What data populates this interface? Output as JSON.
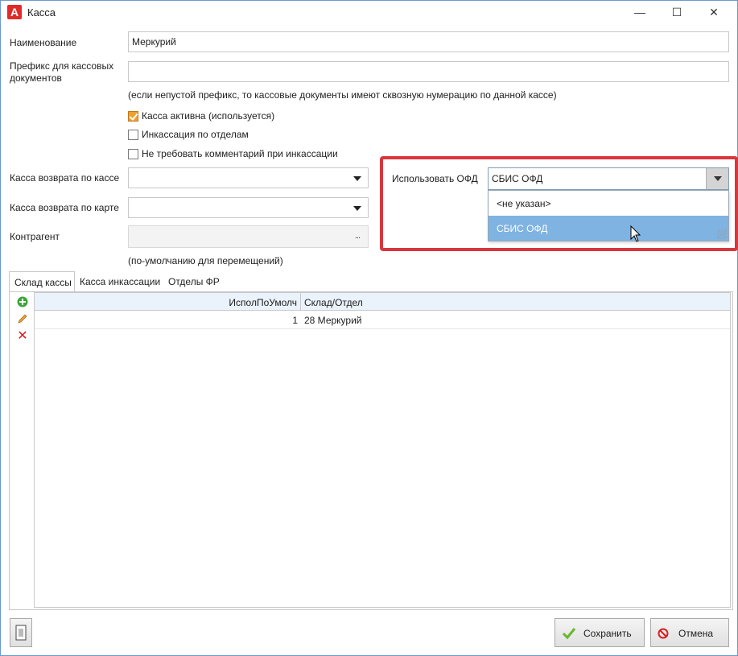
{
  "window": {
    "title": "Касса",
    "app_icon": "A",
    "btn_minimize": "—",
    "btn_maximize": "☐",
    "btn_close": "✕"
  },
  "form": {
    "name_label": "Наименование",
    "name_value": "Меркурий",
    "prefix_label": "Префикс для кассовых документов",
    "prefix_value": "",
    "prefix_hint": "(если непустой префикс, то кассовые документы имеют сквозную нумерацию по данной кассе)",
    "checkboxes": [
      {
        "label": "Касса активна (используется)",
        "checked": true
      },
      {
        "label": "Инкассация по отделам",
        "checked": false
      },
      {
        "label": "Не требовать комментарий при инкассации",
        "checked": false
      }
    ],
    "return_cash_label": "Касса возврата по кассе",
    "return_cash_value": "",
    "return_card_label": "Касса возврата по карте",
    "return_card_value": "",
    "contractor_label": "Контрагент",
    "contractor_value": "",
    "contractor_ellipsis": "...",
    "contractor_hint": "(по-умолчанию для перемещений)",
    "ofd_label": "Использовать ОФД",
    "ofd_value": "СБИС ОФД",
    "ofd_options": [
      "<не указан>",
      "СБИС ОФД"
    ],
    "ofd_selected_index": 1
  },
  "tabs": [
    "Склад кассы",
    "Касса инкассации",
    "Отделы ФР"
  ],
  "toolbar": {
    "add_icon": "+",
    "edit_icon": "✎",
    "delete_icon": "✕"
  },
  "grid": {
    "columns": [
      "ИсполПоУмолч",
      "Склад/Отдел"
    ],
    "rows": [
      {
        "default": "1",
        "warehouse": "28 Меркурий"
      }
    ]
  },
  "footer": {
    "save_label": "Сохранить",
    "cancel_label": "Отмена"
  },
  "colors": {
    "highlight": "#d9363e",
    "selected_item": "#7fb3e2",
    "checkbox_checked": "#f0a030",
    "header_bg": "#eaf2fb"
  }
}
